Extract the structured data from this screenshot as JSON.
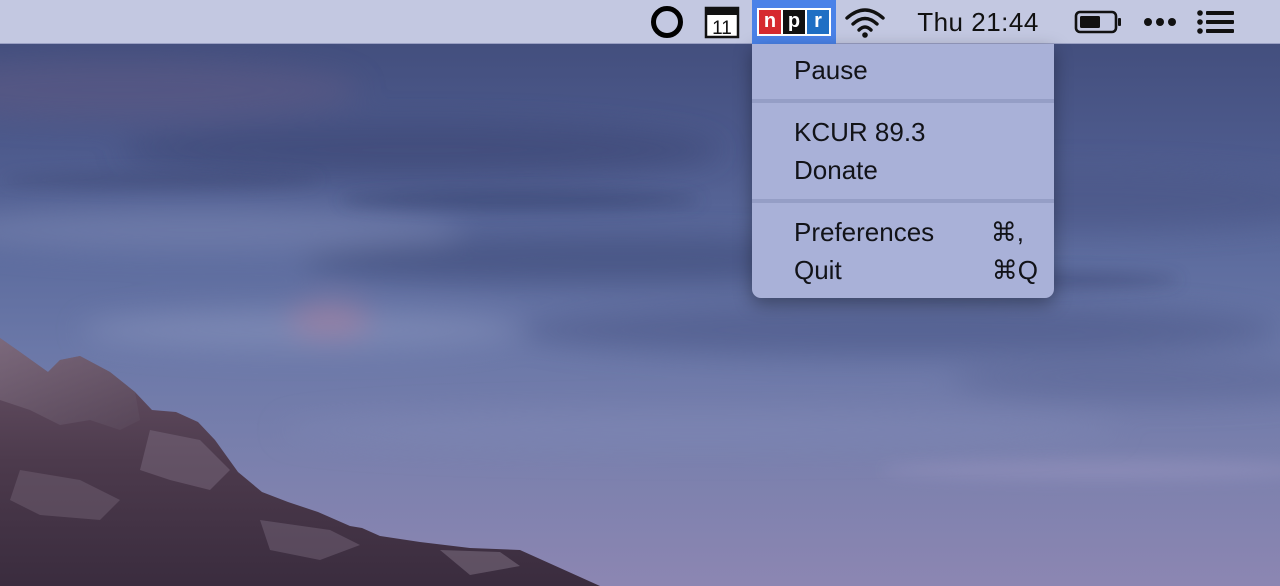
{
  "menubar": {
    "status_items": [
      {
        "icon": "circle-icon"
      },
      {
        "icon": "calendar-icon",
        "text": "11"
      },
      {
        "icon": "npr-icon",
        "letters": [
          "n",
          "p",
          "r"
        ]
      },
      {
        "icon": "wifi-icon"
      }
    ],
    "clock": "Thu 21:44",
    "right_items": [
      {
        "icon": "battery-icon"
      },
      {
        "icon": "more-icon"
      },
      {
        "icon": "notification-center-icon"
      }
    ],
    "background_color": "#c3c8e1",
    "highlight_color": "#4a82e8"
  },
  "npr_menu": {
    "items": [
      {
        "label": "Pause",
        "shortcut": ""
      },
      {
        "label": "KCUR 89.3",
        "shortcut": ""
      },
      {
        "label": "Donate",
        "shortcut": ""
      },
      {
        "label": "Preferences",
        "shortcut": "⌘,"
      },
      {
        "label": "Quit",
        "shortcut": "⌘Q"
      }
    ]
  },
  "npr_colors": {
    "n": "#d6292f",
    "p": "#111111",
    "r": "#1f6fc4"
  }
}
